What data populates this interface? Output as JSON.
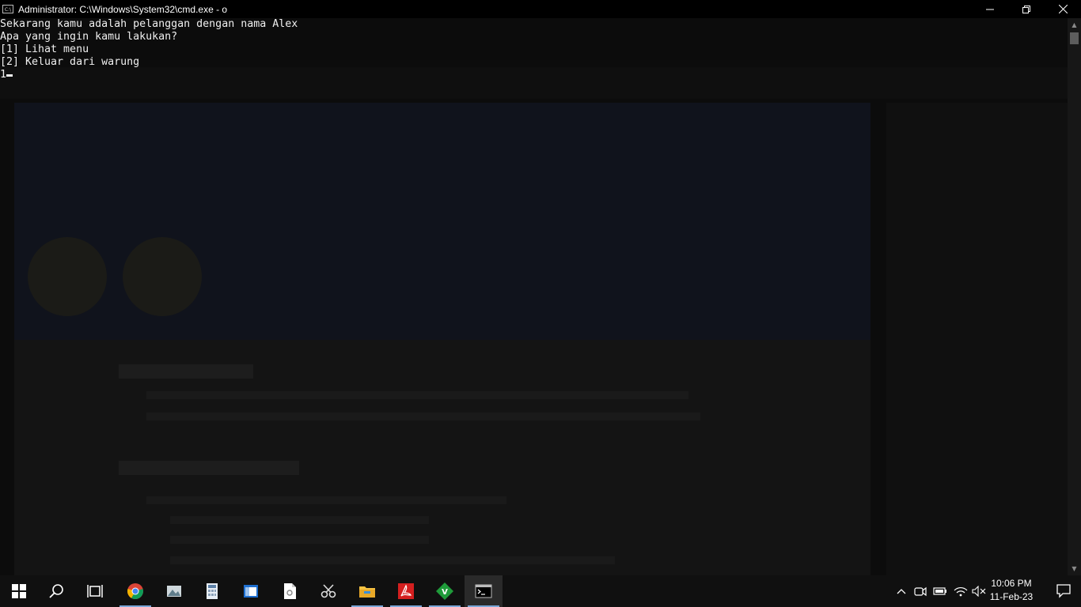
{
  "window": {
    "title": "Administrator: C:\\Windows\\System32\\cmd.exe - o",
    "icon": "cmd-icon"
  },
  "console": {
    "lines": [
      "Sekarang kamu adalah pelanggan dengan nama Alex",
      "Apa yang ingin kamu lakukan?",
      "[1] Lihat menu",
      "[2] Keluar dari warung",
      "1"
    ]
  },
  "taskbar": {
    "apps": [
      {
        "name": "start-icon"
      },
      {
        "name": "search-icon"
      },
      {
        "name": "task-view-icon"
      },
      {
        "name": "chrome-icon"
      },
      {
        "name": "photos-icon"
      },
      {
        "name": "calculator-icon"
      },
      {
        "name": "window-app-icon"
      },
      {
        "name": "document-app-icon"
      },
      {
        "name": "snipping-tool-icon"
      },
      {
        "name": "file-explorer-icon"
      },
      {
        "name": "acrobat-icon"
      },
      {
        "name": "vim-icon"
      },
      {
        "name": "cmd-taskbar-icon"
      }
    ],
    "tray": [
      "chevron-up-icon",
      "meet-now-icon",
      "battery-icon",
      "network-icon",
      "volume-muted-icon"
    ],
    "clock": {
      "time": "10:06 PM",
      "date": "11-Feb-23"
    }
  },
  "colors": {
    "console_bg": "#0c0c0c",
    "console_fg": "#f0f0f0",
    "taskbar_bg": "#101010",
    "chrome_red": "#db4437",
    "acrobat_red": "#d41f1f",
    "vim_green": "#1f9b3a",
    "explorer_yellow": "#f5c242"
  }
}
